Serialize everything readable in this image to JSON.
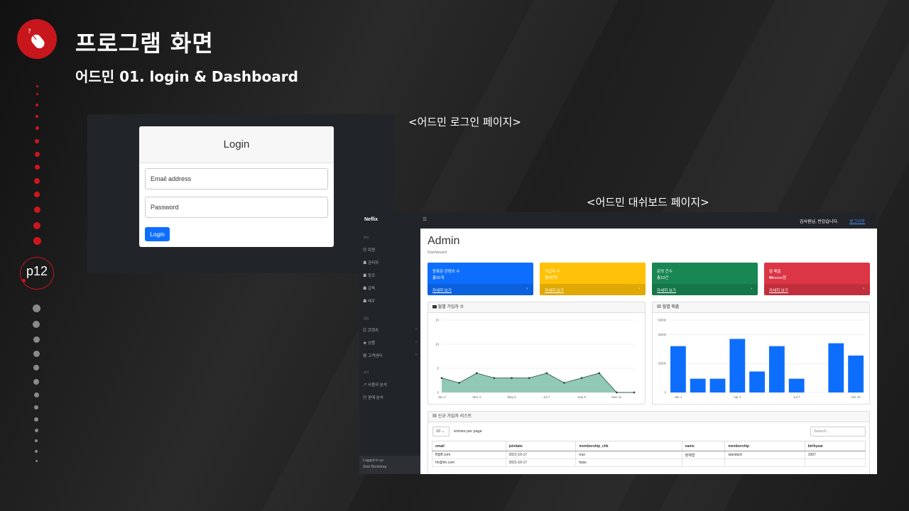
{
  "header": {
    "title": "프로그램 화면",
    "subtitle": "어드민 01. login & Dashboard"
  },
  "timeline": {
    "page_label": "p12"
  },
  "captions": {
    "login": "<어드민 로그인 페이지>",
    "dashboard": "<어드민 대쉬보드 페이지>"
  },
  "login": {
    "title": "Login",
    "email_placeholder": "Email address",
    "password_placeholder": "Password",
    "button": "Login"
  },
  "dashboard": {
    "brand": "Neflix",
    "menu_icon": "☰",
    "greeting": "김사원님, 반갑습니다.",
    "logout": "로그아웃",
    "sidebar": {
      "sections": [
        "관리",
        "통합",
        "분석"
      ],
      "items": [
        {
          "icon": "▤",
          "label": "회원"
        },
        {
          "icon": "☗",
          "label": "관리자"
        },
        {
          "icon": "☗",
          "label": "장르"
        },
        {
          "icon": "☗",
          "label": "감독"
        },
        {
          "icon": "☗",
          "label": "배우"
        },
        {
          "icon": "▥",
          "label": "콘텐츠"
        },
        {
          "icon": "★",
          "label": "상품"
        },
        {
          "icon": "▦",
          "label": "고객센터"
        },
        {
          "icon": "↗",
          "label": "사용자 분석"
        },
        {
          "icon": "▤",
          "label": "판매 분석"
        }
      ],
      "chevron": "›",
      "footer_line1": "Logged in as:",
      "footer_line2": "Start Bootstrap"
    },
    "page_title": "Admin",
    "page_subtitle": "Dashboard",
    "cards": [
      {
        "label": "등록된 콘텐츠 수",
        "value": "총15개",
        "link": "자세히 보기",
        "color": "#0d6efd"
      },
      {
        "label": "가입자 수",
        "value": "총5만명",
        "link": "자세히 보기",
        "color": "#ffc107"
      },
      {
        "label": "문의 건수",
        "value": "총10건",
        "link": "자세히 보기",
        "color": "#198754"
      },
      {
        "label": "월 매출",
        "value": "₩xxxxx원",
        "link": "자세히 보기",
        "color": "#dc3545"
      }
    ],
    "card_arrow": "›",
    "area_chart_title": "월별 가입자 수",
    "bar_chart_title": "월별 매출",
    "table_title": "신규 가입자 리스트",
    "entries_value": "10",
    "entries_label": "entries per page",
    "search_placeholder": "Search...",
    "table": {
      "columns": [
        "email",
        "joindate",
        "membership_chk",
        "name",
        "membership",
        "birthyear"
      ],
      "rows": [
        [
          "ff@ff.com",
          "2021-10-17",
          "true",
          "정재형",
          "standard",
          "1997"
        ],
        [
          "hh@hh.com",
          "2021-10-17",
          "false",
          "",
          "",
          ""
        ]
      ]
    }
  },
  "chart_data": [
    {
      "type": "area",
      "title": "월별 가입자 수",
      "x": [
        "Jan 1",
        "Feb 2",
        "Mar 3",
        "Apr 4",
        "May 5",
        "Jun 6",
        "Jul 7",
        "Aug 8",
        "Sep 9",
        "Oct 10",
        "Nov 11",
        "Dec 12"
      ],
      "x_tick_labels": [
        "Jan 1",
        "Mar 3",
        "May 5",
        "Jul 7",
        "Sep 9",
        "Nov 11"
      ],
      "values": [
        3,
        2,
        4,
        3,
        3,
        3,
        4,
        2,
        3,
        4,
        0,
        0
      ],
      "ylim": [
        0,
        15
      ],
      "y_ticks": [
        0,
        5,
        10,
        15
      ],
      "grid": true,
      "color": "#7fbfa9"
    },
    {
      "type": "bar",
      "title": "월별 매출",
      "x": [
        "Jan 1",
        "Feb 2",
        "Mar 3",
        "Apr 4",
        "May 5",
        "Jun 6",
        "Jul 7",
        "Aug 8",
        "Sep 9",
        "Oct 10"
      ],
      "x_tick_labels": [
        "Jan 1",
        "Apr 4",
        "Jul 7",
        "Oct 10"
      ],
      "values": [
        32000,
        9500,
        9500,
        37000,
        14500,
        32000,
        9500,
        0,
        34000,
        25500
      ],
      "ylim": [
        0,
        50000
      ],
      "y_ticks": [
        0,
        20000,
        40000,
        50000
      ],
      "grid": true,
      "color": "#0d6efd"
    }
  ]
}
